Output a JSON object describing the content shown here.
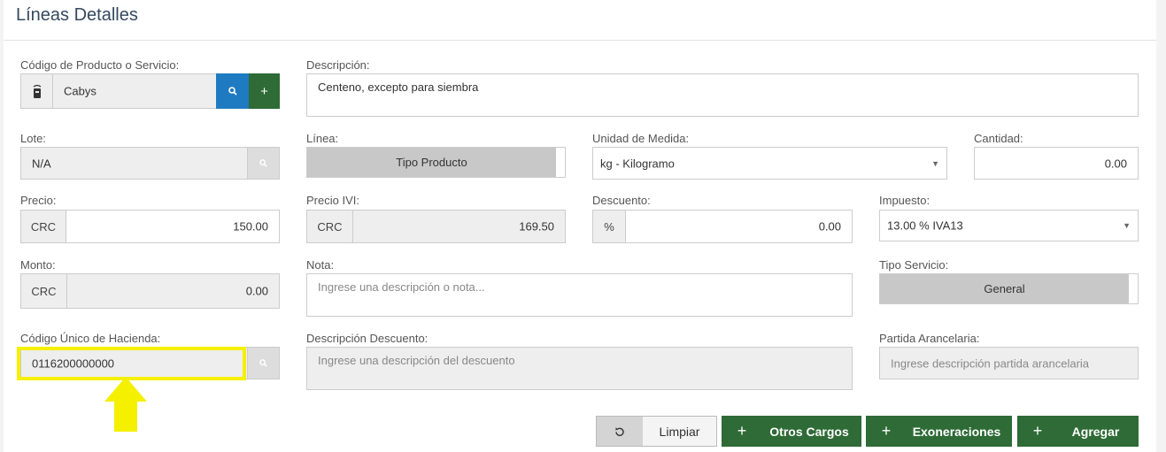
{
  "panel": {
    "title": "Líneas Detalles"
  },
  "codigo": {
    "label": "Código de Producto o Servicio:",
    "value": "Cabys",
    "icon": "barcode-scanner-icon"
  },
  "descripcion": {
    "label": "Descripción:",
    "value": "Centeno, excepto para siembra"
  },
  "lote": {
    "label": "Lote:",
    "value": "N/A"
  },
  "linea": {
    "label": "Línea:",
    "value": "Tipo Producto"
  },
  "unidad": {
    "label": "Unidad de Medida:",
    "value": "kg - Kilogramo"
  },
  "cantidad": {
    "label": "Cantidad:",
    "value": "0.00"
  },
  "precio": {
    "label": "Precio:",
    "currency": "CRC",
    "value": "150.00"
  },
  "precio_ivi": {
    "label": "Precio IVI:",
    "currency": "CRC",
    "value": "169.50"
  },
  "descuento": {
    "label": "Descuento:",
    "unit": "%",
    "value": "0.00"
  },
  "impuesto": {
    "label": "Impuesto:",
    "value": "13.00 % IVA13"
  },
  "monto": {
    "label": "Monto:",
    "currency": "CRC",
    "value": "0.00"
  },
  "nota": {
    "label": "Nota:",
    "placeholder": "Ingrese una descripción o nota..."
  },
  "tipo_servicio": {
    "label": "Tipo Servicio:",
    "value": "General"
  },
  "codigo_hacienda": {
    "label": "Código Único de Hacienda:",
    "value": "0116200000000"
  },
  "descripcion_descuento": {
    "label": "Descripción Descuento:",
    "placeholder": "Ingrese una descripción del descuento"
  },
  "partida": {
    "label": "Partida Arancelaria:",
    "placeholder": "Ingrese descripción partida arancelaria"
  },
  "buttons": {
    "limpiar": "Limpiar",
    "otros_cargos": "Otros Cargos",
    "exoneraciones": "Exoneraciones",
    "agregar": "Agregar",
    "plus": "+"
  },
  "colors": {
    "primary_green": "#2e6b36",
    "search_blue": "#1f7bc1",
    "highlight_yellow": "#f5f000"
  }
}
